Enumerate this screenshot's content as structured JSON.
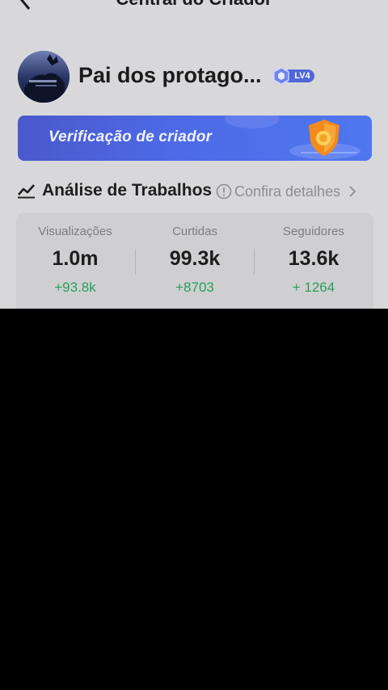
{
  "header": {
    "title": "Central do Criador",
    "back_icon": "chevron-left-icon"
  },
  "profile": {
    "username": "Pai dos protago...",
    "level": "LV4"
  },
  "banner": {
    "text": "Verificação de criador",
    "icon": "shield-coin-icon"
  },
  "analysis": {
    "title": "Análise de Trabalhos",
    "details_label": "Confira detalhes",
    "icon": "trend-chart-icon"
  },
  "stats": [
    {
      "label": "Visualizações",
      "value": "1.0m",
      "delta": "+93.8k"
    },
    {
      "label": "Curtidas",
      "value": "99.3k",
      "delta": "+8703"
    },
    {
      "label": "Seguidores",
      "value": "13.6k",
      "delta": "+ 1264"
    }
  ],
  "colors": {
    "background": "#d8d8da",
    "banner": "#4d6ae6",
    "positive": "#27a05a",
    "overlay": "#000000"
  }
}
